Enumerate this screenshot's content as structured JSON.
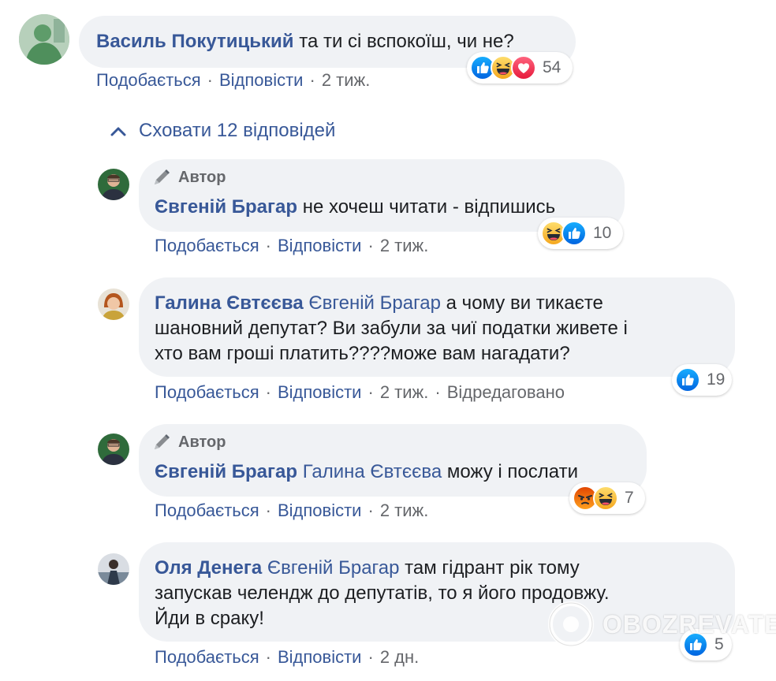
{
  "comments": [
    {
      "author": "Василь Покутицький",
      "mention": "",
      "lines": [
        "та ти сі вспокоїш, чи не?"
      ],
      "actions": {
        "like": "Подобається",
        "reply": "Відповісти",
        "time": "2 тиж."
      },
      "reaction_count": "54",
      "reaction_icons": [
        "like-icon",
        "haha-icon",
        "love-icon"
      ]
    },
    {
      "author_badge": "Автор",
      "author": "Євгеній Брагар",
      "lines": [
        "не хочеш читати - відпишись"
      ],
      "actions": {
        "like": "Подобається",
        "reply": "Відповісти",
        "time": "2 тиж."
      },
      "reaction_count": "10",
      "reaction_icons": [
        "haha-icon",
        "like-icon"
      ]
    },
    {
      "author": "Галина Євтєєва",
      "mention": "Євгеній Брагар",
      "lines": [
        " а чому ви тикаєте",
        "шановний депутат? Ви забули за чиї податки живете і",
        "хто вам гроші платить????може вам нагадати?"
      ],
      "actions": {
        "like": "Подобається",
        "reply": "Відповісти",
        "time": "2 тиж.",
        "edited": "Відредаговано"
      },
      "reaction_count": "19",
      "reaction_icons": [
        "like-icon"
      ]
    },
    {
      "author_badge": "Автор",
      "author": "Євгеній Брагар",
      "mention": "Галина Євтєєва",
      "lines": [
        " можу і послати"
      ],
      "actions": {
        "like": "Подобається",
        "reply": "Відповісти",
        "time": "2 тиж."
      },
      "reaction_count": "7",
      "reaction_icons": [
        "angry-icon",
        "haha-icon"
      ]
    },
    {
      "author": "Оля Денега",
      "mention": "Євгеній Брагар",
      "lines": [
        " там гідрант рік тому",
        "запускав челендж до депутатів, то я його продовжу.",
        "Йди в сраку!"
      ],
      "actions": {
        "like": "Подобається",
        "reply": "Відповісти",
        "time": "2 дн."
      },
      "reaction_count": "5",
      "reaction_icons": [
        "like-icon"
      ]
    }
  ],
  "toggle_replies": "Сховати 12 відповідей",
  "separator": "·",
  "watermark": "OBOZREVATEL",
  "colors": {
    "link": "#385898",
    "muted": "#65676b",
    "bubble": "#f0f2f5",
    "like": "#1877f2",
    "love": "#f33e58",
    "haha": "#f7b125",
    "angry": "#e9710f"
  }
}
